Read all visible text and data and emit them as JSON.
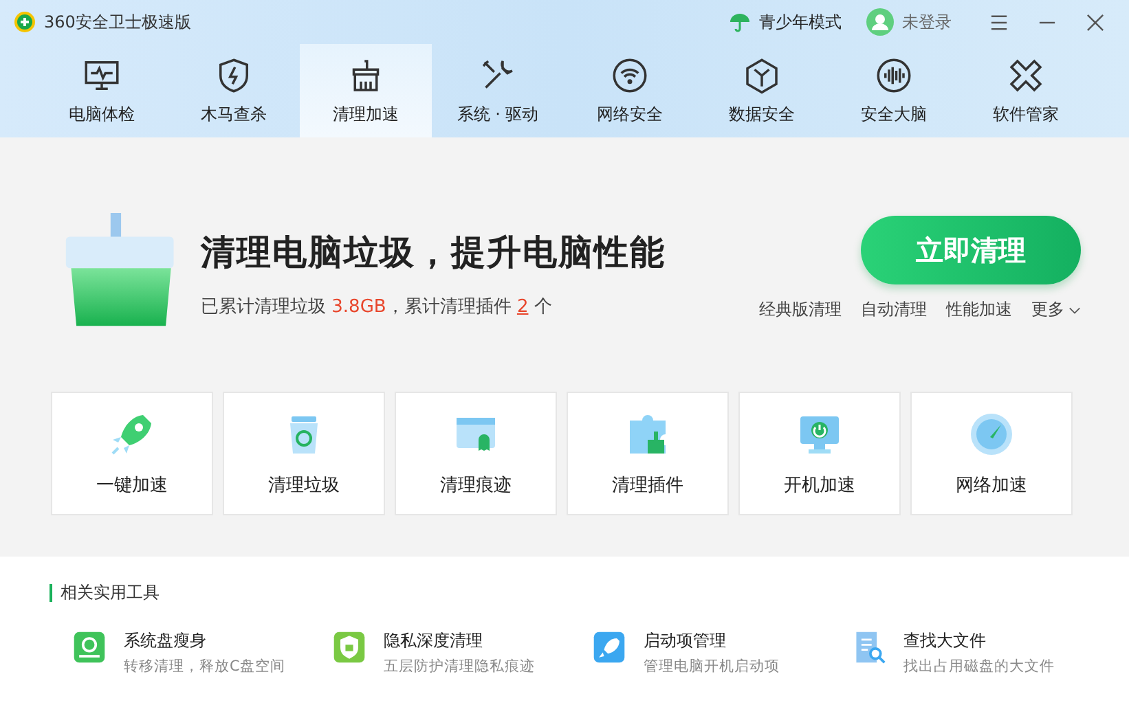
{
  "window": {
    "title": "360安全卫士极速版",
    "youth_mode": "青少年模式",
    "login": "未登录"
  },
  "nav": [
    {
      "label": "电脑体检",
      "selected": false
    },
    {
      "label": "木马查杀",
      "selected": false
    },
    {
      "label": "清理加速",
      "selected": true
    },
    {
      "label": "系统 · 驱动",
      "selected": false
    },
    {
      "label": "网络安全",
      "selected": false
    },
    {
      "label": "数据安全",
      "selected": false
    },
    {
      "label": "安全大脑",
      "selected": false
    },
    {
      "label": "软件管家",
      "selected": false
    }
  ],
  "hero": {
    "title": "清理电脑垃圾，提升电脑性能",
    "stats": {
      "prefix": "已累计清理垃圾",
      "size": "3.8GB",
      "middle": "，累计清理插件",
      "count": "2",
      "suffix": "个"
    },
    "button": "立即清理",
    "links": [
      "经典版清理",
      "自动清理",
      "性能加速"
    ],
    "more": "更多"
  },
  "tiles": [
    "一键加速",
    "清理垃圾",
    "清理痕迹",
    "清理插件",
    "开机加速",
    "网络加速"
  ],
  "tools_heading": "相关实用工具",
  "tools": [
    {
      "title": "系统盘瘦身",
      "desc": "转移清理，释放C盘空间"
    },
    {
      "title": "隐私深度清理",
      "desc": "五层防护清理隐私痕迹"
    },
    {
      "title": "启动项管理",
      "desc": "管理电脑开机启动项"
    },
    {
      "title": "查找大文件",
      "desc": "找出占用磁盘的大文件"
    }
  ]
}
